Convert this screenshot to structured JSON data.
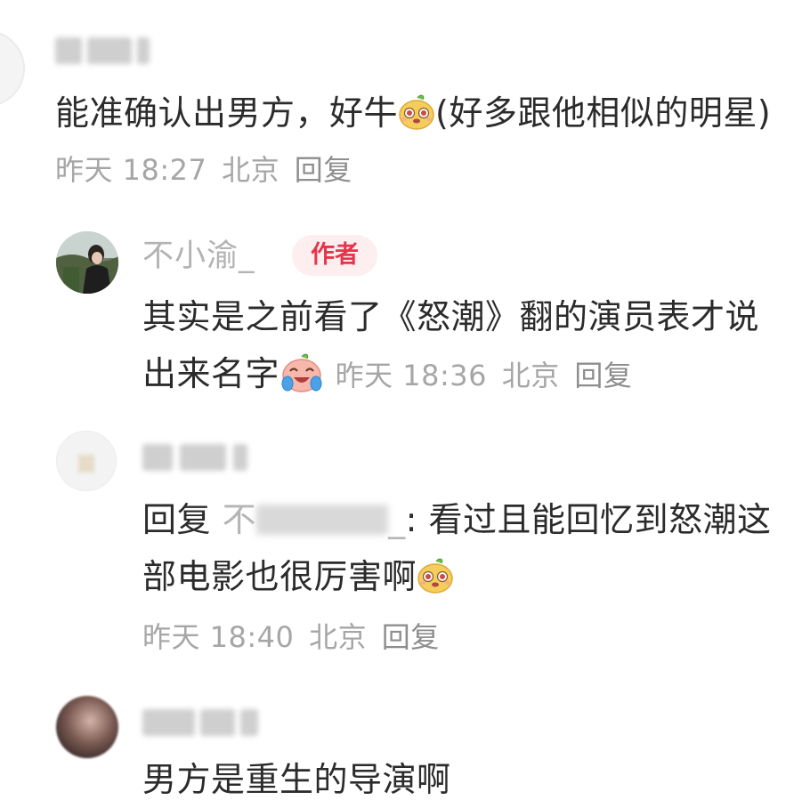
{
  "comments": [
    {
      "username": "",
      "username_blurred": true,
      "text_before_emoji": "能准确认出男方，好牛",
      "emoji": "bear-smile-emoji",
      "text_after_emoji": "(好多跟他相似的明星)",
      "time": "昨天 18:27",
      "location": "北京",
      "reply_label": "回复"
    }
  ],
  "replies": [
    {
      "username": "不小渝_",
      "badge": "作者",
      "text_before_emoji": "其实是之前看了《怒潮》翻的演员表才说出来名字",
      "emoji": "laugh-cry-emoji",
      "time": "昨天 18:36",
      "location": "北京",
      "reply_label": "回复"
    },
    {
      "username": "",
      "username_blurred": true,
      "reply_prefix": "回复",
      "mention_start": "不",
      "mention_end": "_",
      "text_before_emoji": ": 看过且能回忆到怒潮这部电影也很厉害啊",
      "emoji": "bear-smile-emoji",
      "time": "昨天 18:40",
      "location": "北京",
      "reply_label": "回复"
    },
    {
      "username": "",
      "username_blurred": true,
      "text": "男方是重生的导演啊"
    }
  ],
  "colors": {
    "text_primary": "#2b2b2b",
    "text_meta": "#a6a6a6",
    "author_badge_text": "#e6354b",
    "author_badge_bg": "#fdeef0"
  }
}
